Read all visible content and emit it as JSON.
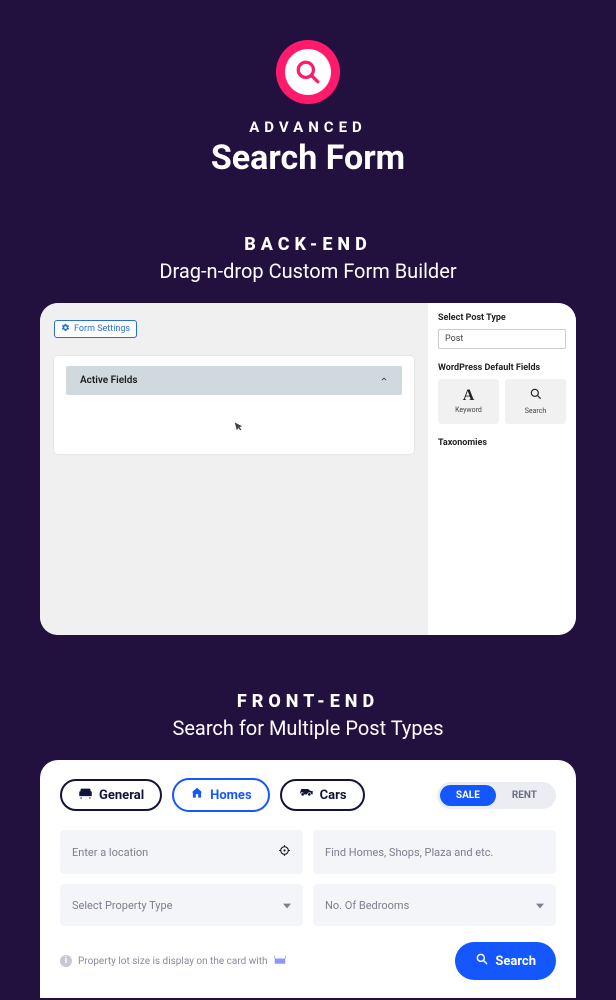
{
  "hero": {
    "kicker": "ADVANCED",
    "title": "Search Form"
  },
  "backend": {
    "kicker": "BACK-END",
    "subtitle": "Drag-n-drop Custom Form Builder",
    "form_settings_label": "Form Settings",
    "active_fields_label": "Active Fields",
    "sidebar": {
      "select_post_type_label": "Select Post Type",
      "select_post_type_value": "Post",
      "default_fields_label": "WordPress Default Fields",
      "chip_keyword_glyph": "A",
      "chip_keyword_label": "Keyword",
      "chip_search_label": "Search",
      "taxonomies_label": "Taxonomies"
    }
  },
  "frontend": {
    "kicker": "FRONT-END",
    "subtitle": "Search for Multiple Post Types",
    "pills": {
      "general": "General",
      "homes": "Homes",
      "cars": "Cars"
    },
    "toggle": {
      "sale": "SALE",
      "rent": "RENT"
    },
    "inputs": {
      "location_placeholder": "Enter a location",
      "find_placeholder": "Find Homes, Shops, Plaza and etc.",
      "property_type_placeholder": "Select Property Type",
      "bedrooms_placeholder": "No. Of Bedrooms"
    },
    "hint": "Property lot size is display on the card with",
    "search_label": "Search"
  }
}
